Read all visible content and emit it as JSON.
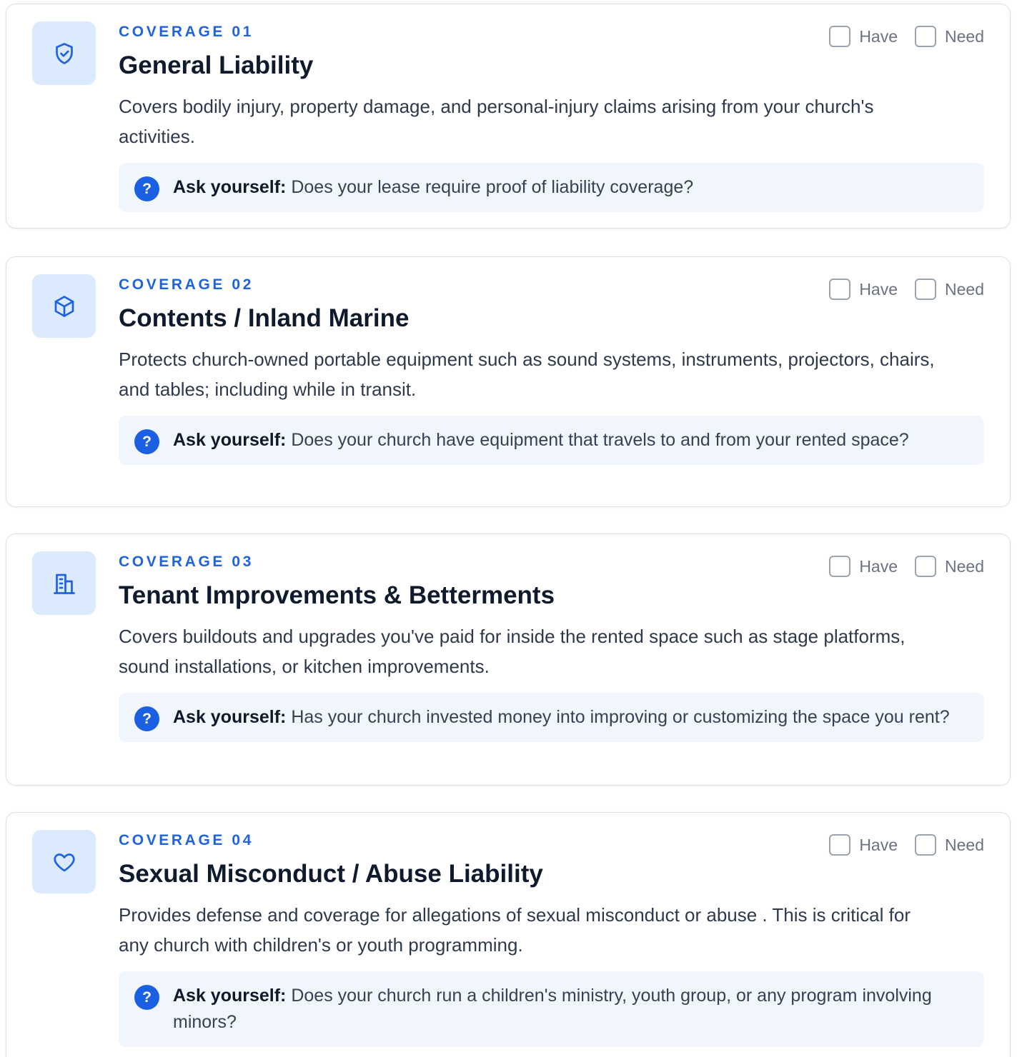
{
  "colors": {
    "accent": "#1f63e0",
    "icon_tile_bg": "#dceafd",
    "ask_bg": "#f1f6fd",
    "question_badge": "#1b5fe3"
  },
  "coverages": [
    {
      "eyebrow": "COVERAGE 01",
      "icon": "shield-check-icon",
      "title": "General Liability",
      "description": "Covers bodily injury, property damage, and personal-injury claims arising from your church's activities.",
      "ask_label": "Ask yourself:",
      "ask_text": "Does your lease require proof of liability coverage?",
      "have_label": "Have",
      "need_label": "Need"
    },
    {
      "eyebrow": "COVERAGE 02",
      "icon": "box-icon",
      "title": "Contents / Inland Marine",
      "description": "Protects church-owned portable equipment such as sound systems, instruments, projectors, chairs, and tables; including while in transit.",
      "ask_label": "Ask yourself:",
      "ask_text": "Does your church have equipment that travels to and from your rented space?",
      "have_label": "Have",
      "need_label": "Need"
    },
    {
      "eyebrow": "COVERAGE 03",
      "icon": "building-icon",
      "title": "Tenant Improvements & Betterments",
      "description": "Covers buildouts and upgrades you've paid for inside the rented space such as stage platforms, sound installations, or kitchen improvements.",
      "ask_label": "Ask yourself:",
      "ask_text": "Has your church invested money into improving or customizing the space you rent?",
      "have_label": "Have",
      "need_label": "Need"
    },
    {
      "eyebrow": "COVERAGE 04",
      "icon": "heart-icon",
      "title": "Sexual Misconduct / Abuse Liability",
      "description": "Provides defense and coverage for allegations of sexual misconduct or abuse . This is critical for any church with children's or youth programming.",
      "ask_label": "Ask yourself:",
      "ask_text": "Does your church run a children's ministry, youth group, or any program involving minors?",
      "have_label": "Have",
      "need_label": "Need"
    }
  ]
}
